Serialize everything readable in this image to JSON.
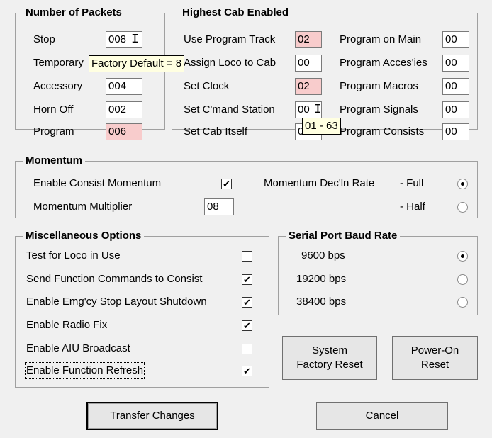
{
  "packets": {
    "title": "Number of Packets",
    "rows": [
      {
        "label": "Stop",
        "value": "008",
        "highlight": false
      },
      {
        "label": "Temporary",
        "value": "",
        "highlight": false
      },
      {
        "label": "Accessory",
        "value": "004",
        "highlight": false
      },
      {
        "label": "Horn Off",
        "value": "002",
        "highlight": false
      },
      {
        "label": "Program",
        "value": "006",
        "highlight": true
      }
    ]
  },
  "cab": {
    "title": "Highest Cab Enabled",
    "left": [
      {
        "label": "Use Program Track",
        "value": "02",
        "highlight": true
      },
      {
        "label": "Assign Loco to Cab",
        "value": "00",
        "highlight": false
      },
      {
        "label": "Set Clock",
        "value": "02",
        "highlight": true
      },
      {
        "label": "Set C'mand Station",
        "value": "00",
        "highlight": false
      },
      {
        "label": "Set Cab Itself",
        "value": "00",
        "highlight": false
      }
    ],
    "right": [
      {
        "label": "Program on Main",
        "value": "00"
      },
      {
        "label": "Program Acces'ies",
        "value": "00"
      },
      {
        "label": "Program Macros",
        "value": "00"
      },
      {
        "label": "Program Signals",
        "value": "00"
      },
      {
        "label": "Program Consists",
        "value": "00"
      }
    ]
  },
  "tooltips": {
    "factory": "Factory Default = 8",
    "range": "01 - 63"
  },
  "momentum": {
    "title": "Momentum",
    "consist_label": "Enable Consist Momentum",
    "consist_checked": "✔",
    "multiplier_label": "Momentum Multiplier",
    "multiplier_value": "08",
    "rate_label": "Momentum Dec'ln Rate",
    "full_label": "-   Full",
    "half_label": "-   Half",
    "selected": "full"
  },
  "misc": {
    "title": "Miscellaneous Options",
    "items": [
      {
        "label": "Test for Loco in Use",
        "mark": ""
      },
      {
        "label": "Send Function Commands to Consist",
        "mark": "✔"
      },
      {
        "label": "Enable Emg'cy Stop Layout Shutdown",
        "mark": "✔"
      },
      {
        "label": "Enable Radio Fix",
        "mark": "✔"
      },
      {
        "label": "Enable AIU Broadcast",
        "mark": ""
      },
      {
        "label": "Enable Function Refresh",
        "mark": "✔"
      }
    ]
  },
  "baud": {
    "title": "Serial Port Baud Rate",
    "options": [
      "9600 bps",
      "19200 bps",
      "38400 bps"
    ],
    "selected_index": 0
  },
  "buttons": {
    "system_reset": "System Factory Reset",
    "power_reset": "Power-On Reset",
    "transfer": "Transfer Changes",
    "cancel": "Cancel"
  }
}
